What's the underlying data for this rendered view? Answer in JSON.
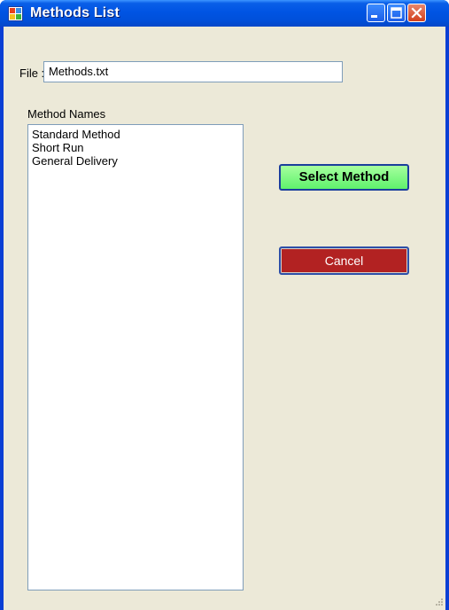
{
  "window": {
    "title": "Methods List",
    "icons": {
      "app": "app-window-icon",
      "minimize": "minimize-icon",
      "maximize": "maximize-icon",
      "close": "close-icon"
    }
  },
  "file": {
    "label": "File :",
    "value": "Methods.txt"
  },
  "methods": {
    "label": "Method Names",
    "items": [
      "Standard Method",
      "Short Run",
      "General Delivery"
    ]
  },
  "buttons": {
    "select": "Select Method",
    "cancel": "Cancel"
  },
  "colors": {
    "titlebar": "#0054e3",
    "window_bg": "#ece9d8",
    "select_button": "#5ff26c",
    "cancel_button": "#b22222"
  }
}
